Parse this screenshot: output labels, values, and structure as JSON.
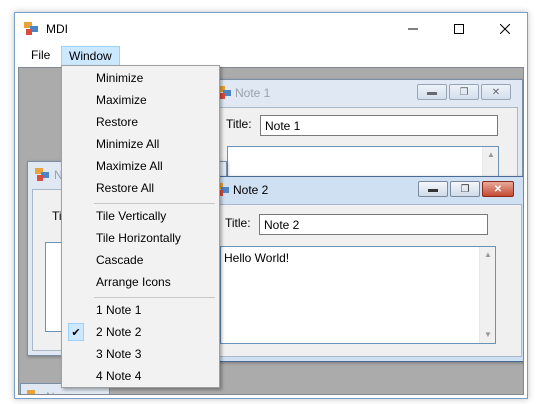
{
  "window": {
    "title": "MDI",
    "minimize_icon": "minimize-icon",
    "maximize_icon": "maximize-icon",
    "close_icon": "close-icon"
  },
  "menubar": {
    "items": [
      {
        "label": "File"
      },
      {
        "label": "Window"
      }
    ]
  },
  "window_menu": {
    "groups": [
      [
        "Minimize",
        "Maximize",
        "Restore",
        "Minimize All",
        "Maximize All",
        "Restore All"
      ],
      [
        "Tile Vertically",
        "Tile Horizontally",
        "Cascade",
        "Arrange Icons"
      ],
      [
        "1 Note 1",
        "2 Note 2",
        "3 Note 3",
        "4 Note 4"
      ]
    ],
    "checked_item": "2 Note 2"
  },
  "note1": {
    "title": "Note 1",
    "field_label": "Title:",
    "title_value": "Note 1"
  },
  "note2": {
    "title": "Note 2",
    "field_label": "Title:",
    "title_value": "Note 2",
    "body": "Hello World!"
  },
  "note3": {
    "title": "No",
    "field_label": "Ti"
  },
  "note4": {
    "title": "No"
  },
  "colors": {
    "mdi_background": "#ababab",
    "menu_highlight": "#cce8ff",
    "close_red": "#c44a33"
  }
}
